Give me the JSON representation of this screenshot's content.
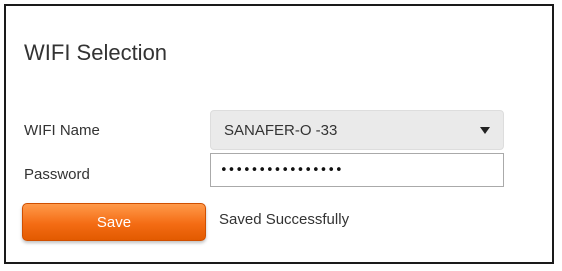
{
  "panel": {
    "title": "WIFI Selection"
  },
  "form": {
    "wifi_label": "WIFI Name",
    "wifi_value": "SANAFER-O -33",
    "password_label": "Password",
    "password_value": "••••••••••••••••"
  },
  "actions": {
    "save_label": "Save",
    "status_message": "Saved Successfully"
  },
  "colors": {
    "accent": "#f46c14",
    "border": "#1a1a1a"
  },
  "icons": {
    "dropdown": "chevron-down-icon"
  }
}
